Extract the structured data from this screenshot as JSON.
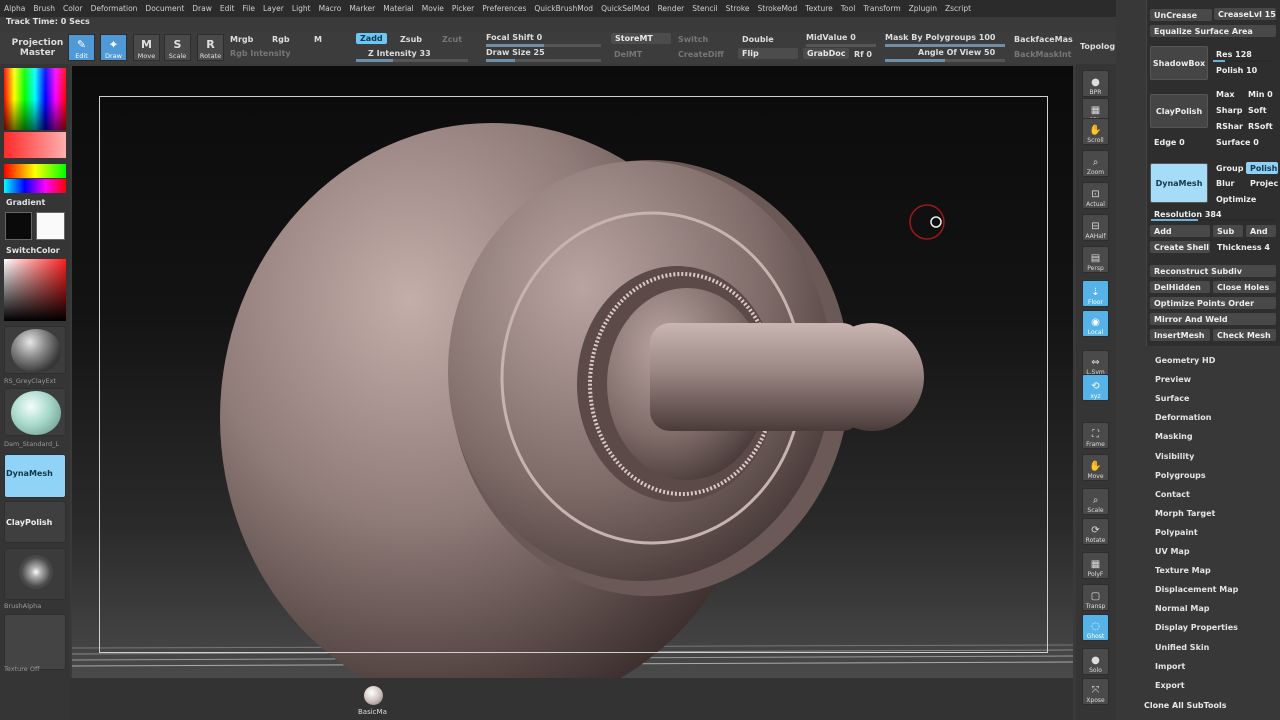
{
  "menu": [
    "Alpha",
    "Brush",
    "Color",
    "Deformation",
    "Document",
    "Draw",
    "Edit",
    "File",
    "Layer",
    "Light",
    "Macro",
    "Marker",
    "Material",
    "Movie",
    "Picker",
    "Preferences",
    "QuickBrushMod",
    "QuickSelMod",
    "Render",
    "Stencil",
    "Stroke",
    "StrokeMod",
    "Texture",
    "Tool",
    "Transform",
    "Zplugin",
    "Zscript"
  ],
  "track_time": "Track Time: 0 Secs",
  "toolbar": {
    "projection_master": "Projection Master",
    "edit": "Edit",
    "draw": "Draw",
    "move": "Move",
    "scale": "Scale",
    "rotate": "Rotate",
    "move_ic": "M",
    "scale_ic": "S",
    "rotate_ic": "R",
    "mrgb": "Mrgb",
    "rgb": "Rgb",
    "m": "M",
    "rgb_intensity": "Rgb Intensity",
    "zadd": "Zadd",
    "zsub": "Zsub",
    "zcut": "Zcut",
    "z_intensity": "Z Intensity 33",
    "focal_shift": "Focal Shift 0",
    "draw_size": "Draw Size 25",
    "storemt": "StoreMT",
    "delmt": "DelMT",
    "switch": "Switch",
    "createdifff": "CreateDiff",
    "double": "Double",
    "flip": "Flip",
    "midvalue": "MidValue 0",
    "grabdoc": "GrabDoc",
    "rf": "Rf 0",
    "mask_by_polygroups": "Mask By Polygroups 100",
    "angle_of_view": "Angle Of View 50",
    "backfacemask": "BackfaceMas",
    "backmaskint": "BackMaskInt",
    "topology": "Topolog",
    "z_intensity_level": 0.33,
    "draw_size_level": 0.25,
    "mask_by_polygroups_level": 1.0,
    "angle_of_view_level": 0.5
  },
  "left": {
    "gradient": "Gradient",
    "switchcolor": "SwitchColor",
    "material_caption": "RS_GreyClayExt",
    "brush_caption": "Dam_Standard_L",
    "dynamesh": "DynaMesh",
    "claypolish": "ClayPolish",
    "alpha_caption": "BrushAlpha",
    "texture_caption": "Texture Off"
  },
  "viewport": {
    "bottom_tool_label": "BasicMa"
  },
  "shelf": [
    {
      "label": "BPR",
      "icon": "bpr-icon",
      "active": false
    },
    {
      "label": "SPix",
      "icon": "spix-icon",
      "active": false
    },
    {
      "label": "Scroll",
      "icon": "scroll-icon",
      "active": false
    },
    {
      "label": "Zoom",
      "icon": "zoom-icon",
      "active": false
    },
    {
      "label": "Actual",
      "icon": "actual-icon",
      "active": false
    },
    {
      "label": "AAHalf",
      "icon": "aahalf-icon",
      "active": false
    },
    {
      "label": "Persp",
      "icon": "persp-icon",
      "active": false
    },
    {
      "label": "Floor",
      "icon": "floor-icon",
      "active": true
    },
    {
      "label": "Local",
      "icon": "local-icon",
      "active": true
    },
    {
      "label": "L.Sym",
      "icon": "lsym-icon",
      "active": false
    },
    {
      "label": "xyz",
      "icon": "xyz-icon",
      "active": true
    },
    {
      "label": "Frame",
      "icon": "frame-icon",
      "active": false
    },
    {
      "label": "Move",
      "icon": "move-icon",
      "active": false
    },
    {
      "label": "Scale",
      "icon": "scale-icon",
      "active": false
    },
    {
      "label": "Rotate",
      "icon": "rotate-icon",
      "active": false
    },
    {
      "label": "PolyF",
      "icon": "polyf-icon",
      "active": false
    },
    {
      "label": "Transp",
      "icon": "transp-icon",
      "active": false
    },
    {
      "label": "Ghost",
      "icon": "ghost-icon",
      "active": true
    },
    {
      "label": "Solo",
      "icon": "solo-icon",
      "active": false
    },
    {
      "label": "Xpose",
      "icon": "xpose-icon",
      "active": false
    }
  ],
  "tray": {
    "uncrease": "UnCrease",
    "creaselvl": "CreaseLvl 15",
    "equalize": "Equalize Surface Area",
    "shadowbox": "ShadowBox",
    "res": "Res 128",
    "polish": "Polish 10",
    "claypolish": "ClayPolish",
    "max": "Max",
    "min": "Min 0",
    "sharp": "Sharp",
    "soft": "Soft",
    "rsharp": "RShar",
    "rsoft": "RSoft",
    "edge": "Edge 0",
    "surface": "Surface 0",
    "dynamesh": "DynaMesh",
    "group": "Group",
    "polish_btn": "Polish",
    "blur": "Blur",
    "project": "Projec",
    "optimize": "Optimize",
    "resolution": "Resolution 384",
    "add": "Add",
    "sub": "Sub",
    "and": "And",
    "create_shell": "Create Shell",
    "thickness": "Thickness 4",
    "reconstruct": "Reconstruct Subdiv",
    "delhidden": "DelHidden",
    "close_holes": "Close Holes",
    "optimize_points": "Optimize Points Order",
    "mirror_weld": "Mirror And Weld",
    "insertmesh": "InsertMesh",
    "check_mesh": "Check Mesh"
  },
  "subpalettes": [
    "Geometry HD",
    "Preview",
    "Surface",
    "Deformation",
    "Masking",
    "Visibility",
    "Polygroups",
    "Contact",
    "Morph Target",
    "Polypaint",
    "UV Map",
    "Texture Map",
    "Displacement Map",
    "Normal Map",
    "Display Properties",
    "Unified Skin",
    "Import",
    "Export"
  ],
  "clone_all": "Clone All SubTools"
}
